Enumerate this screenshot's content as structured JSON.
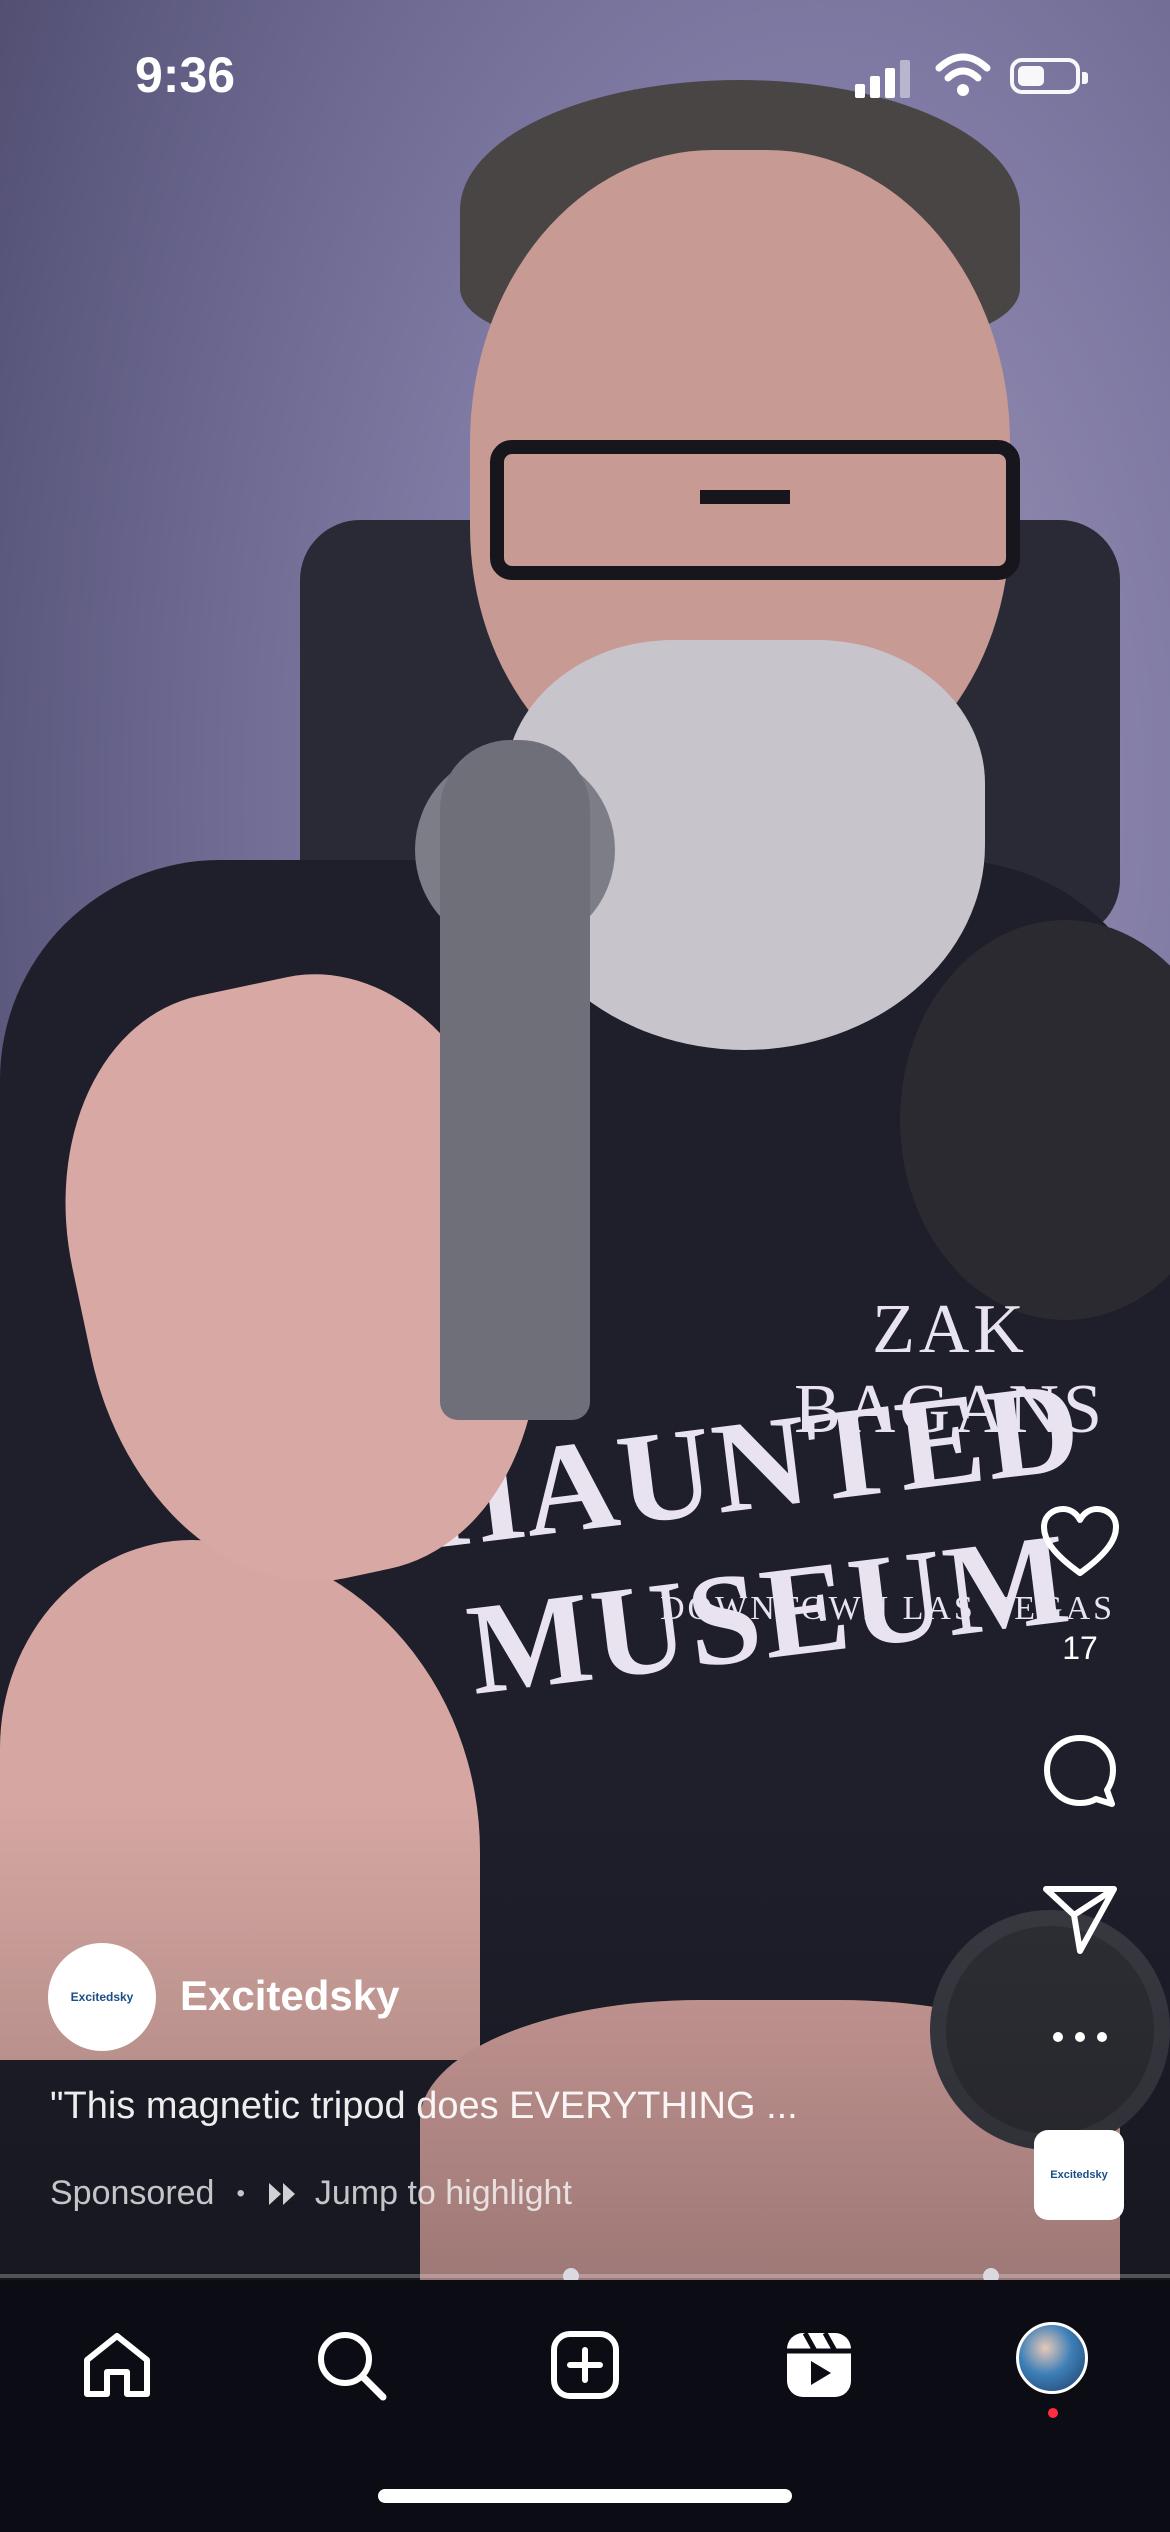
{
  "status_bar": {
    "time": "9:36"
  },
  "video": {
    "shirt_text": {
      "line1": "ZAK BAGANS",
      "line2": "HAUNTED MUSEUM",
      "line3": "DOWNTOWN LAS VEGAS"
    }
  },
  "actions": {
    "like_count": "17",
    "icons": [
      "heart-icon",
      "comment-icon",
      "share-icon",
      "more-icon"
    ]
  },
  "post": {
    "author": "Excitedsky",
    "avatar_text": "Excitedsky",
    "caption": "\"This magnetic tripod does EVERYTHING ...",
    "sponsored_label": "Sponsored",
    "separator": "•",
    "highlight_label": "Jump to highlight",
    "product_thumb_text": "Excitedsky"
  },
  "tab_bar": {
    "items": [
      "home-icon",
      "search-icon",
      "create-icon",
      "reels-icon",
      "profile-avatar"
    ]
  },
  "colors": {
    "notification": "#ff2d3f",
    "tab_bar_bg": "#0b0c14"
  }
}
